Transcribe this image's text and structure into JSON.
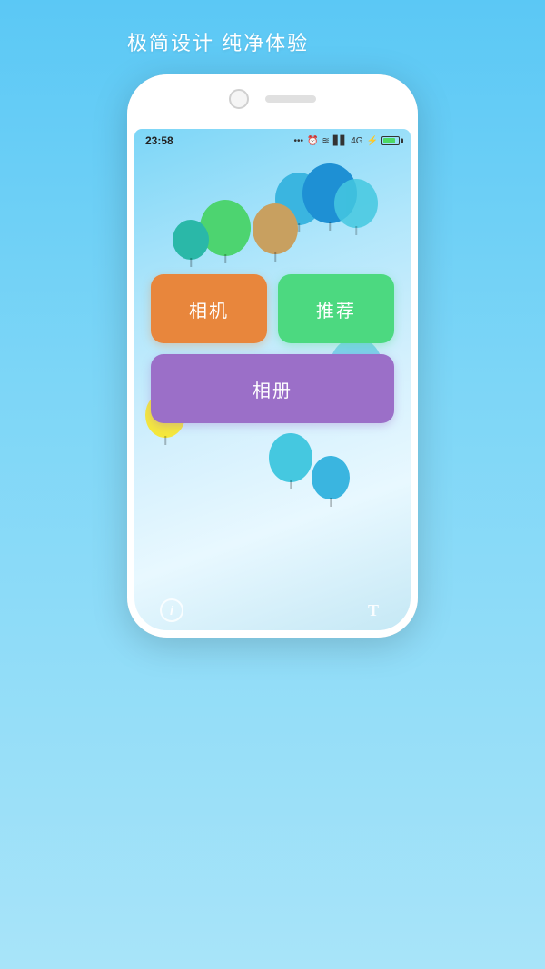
{
  "page": {
    "background": "#5bc8f5",
    "tagline": "极简设计   纯净体验"
  },
  "phone": {
    "status_bar": {
      "time": "23:58",
      "indicators": "... ⏰ ✦ ▋▋ ↑↓ 4G ⚡"
    },
    "buttons": {
      "camera_label": "相机",
      "recommend_label": "推荐",
      "album_label": "相册"
    },
    "bottom": {
      "info_label": "i",
      "t_label": "T"
    }
  }
}
